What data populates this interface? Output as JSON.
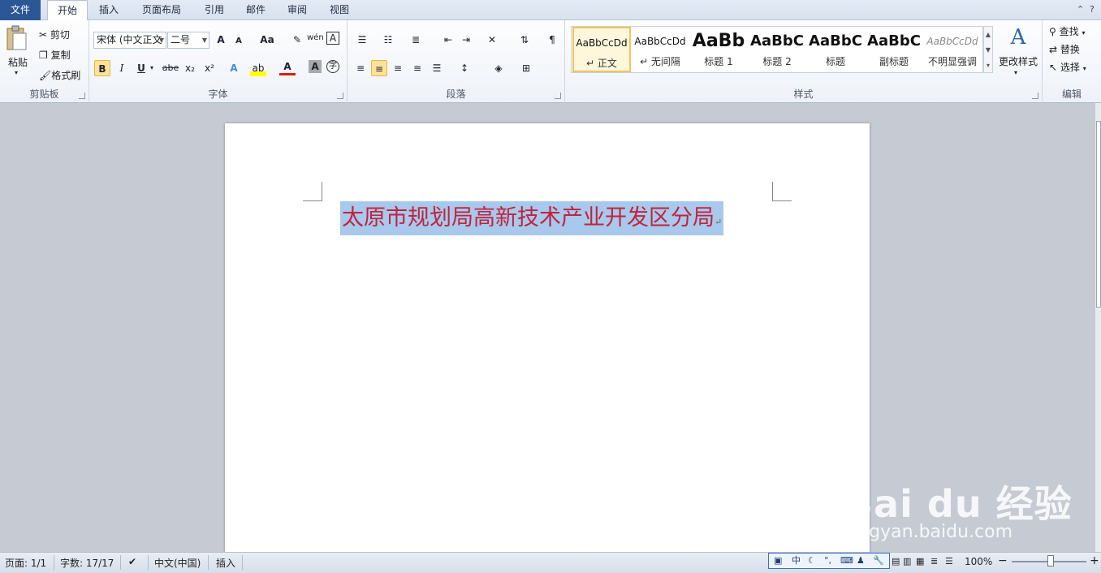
{
  "tabs": [
    {
      "label": "文件"
    },
    {
      "label": "开始"
    },
    {
      "label": "插入"
    },
    {
      "label": "页面布局"
    },
    {
      "label": "引用"
    },
    {
      "label": "邮件"
    },
    {
      "label": "审阅"
    },
    {
      "label": "视图"
    }
  ],
  "clipboard": {
    "label": "剪贴板",
    "paste": "粘贴",
    "cut": "剪切",
    "copy": "复制",
    "format_painter": "格式刷"
  },
  "font": {
    "label": "字体",
    "font_name": "宋体 (中文正文",
    "font_size": "二号",
    "grow": "A",
    "shrink": "A",
    "case": "Aa",
    "bold": "B",
    "italic": "I",
    "underline": "U",
    "strike": "abe",
    "subscript": "x₂",
    "superscript": "x²",
    "wen": "wén",
    "char_border": "A",
    "char_shade": "A",
    "enclose": "字"
  },
  "paragraph": {
    "label": "段落"
  },
  "styles": {
    "label": "样式",
    "change_styles": "更改样式",
    "items": [
      {
        "preview": "AaBbCcDd",
        "name": "↵ 正文"
      },
      {
        "preview": "AaBbCcDd",
        "name": "↵ 无间隔"
      },
      {
        "preview": "AaBb",
        "name": "标题 1"
      },
      {
        "preview": "AaBbC",
        "name": "标题 2"
      },
      {
        "preview": "AaBbC",
        "name": "标题"
      },
      {
        "preview": "AaBbC",
        "name": "副标题"
      },
      {
        "preview": "AaBbCcDd",
        "name": "不明显强调"
      }
    ]
  },
  "editing": {
    "label": "编辑",
    "find": "查找",
    "replace": "替换",
    "select": "选择"
  },
  "document": {
    "title": "太原市规划局高新技术产业开发区分局",
    "para_mark": "↵"
  },
  "status": {
    "page": "页面: 1/1",
    "words": "字数: 17/17",
    "language": "中文(中国)",
    "mode": "插入",
    "zoom": "100%",
    "zoom_minus": "−",
    "zoom_plus": "+"
  },
  "ime": {
    "mode": "中",
    "moon": "☾",
    "punct": "°,"
  },
  "watermark": {
    "brand": "Bai du 经验",
    "url": "jingyan.baidu.com"
  },
  "colors": {
    "file_tab": "#2b5797",
    "selection": "#a8c8ec",
    "title_text": "#c0243c",
    "highlight_button": "#fbe39a"
  }
}
